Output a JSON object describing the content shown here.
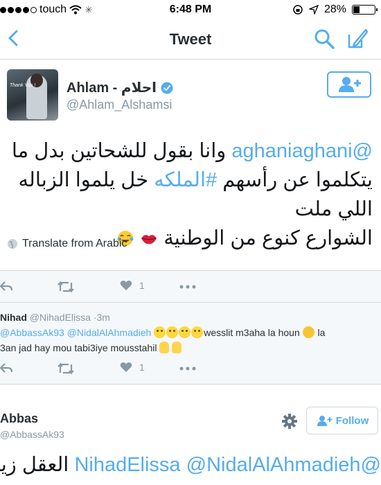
{
  "status_bar": {
    "carrier": "touch",
    "time": "6:48 PM",
    "battery": "28%"
  },
  "nav": {
    "title": "Tweet",
    "icons": [
      "back-chevron-icon",
      "search-icon",
      "compose-icon"
    ]
  },
  "main_tweet": {
    "author_name": "Ahlam - احلام",
    "handle": "@Ahlam_Alshamsi",
    "avatar_caption": "Thank You !",
    "text_line1_mention": "@aghaniaghani",
    "text_line1_rest": "وانا بقول للشحاتين بدل ما",
    "text_line2_start": "يتكلموا عن رأسهم",
    "text_line2_hashtag": "#الملكه",
    "text_line2_end": "خل يلموا الزباله اللي ملت",
    "text_line3": "الشوارع كنوع من الوطنية",
    "translate_label": "Translate from Arabic",
    "likes": "1"
  },
  "reply": {
    "name": "Nihad",
    "handle": "@NihadElissa",
    "separator": "·",
    "time": "3m",
    "mention1": "@AbbassAk93",
    "mention2": "@NidalAlAhmadieh",
    "text_part1": "wesslit m3aha la houn",
    "text_part2": "la",
    "text_line2": "3an jad hay mou tabi3iye mousstahil",
    "likes": "1"
  },
  "third_tweet": {
    "name": "Abbas",
    "handle": "@AbbassAk93",
    "follow_label": "Follow",
    "mention1": "@NidalAlAhmadieh",
    "mention2": "@NihadElissa",
    "arabic_text": "العقل زينة"
  },
  "colors": {
    "accent": "#55acee",
    "text": "#14171a",
    "muted": "#8899a6",
    "panel": "#f5f8fa"
  }
}
